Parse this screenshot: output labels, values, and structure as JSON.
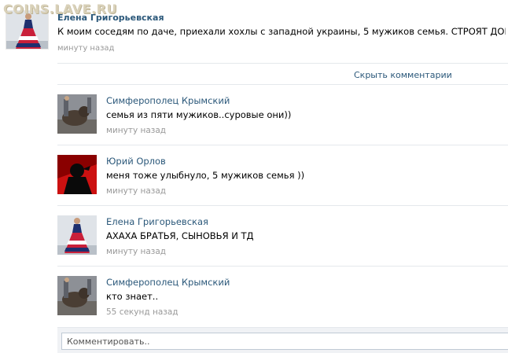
{
  "watermark": "COINS.LAVE.RU",
  "post": {
    "author": "Елена Григорьевская",
    "text": "К моим соседям по даче, приехали хохлы с западной украины, 5 мужиков семья. СТРОЯТ ДОМ...",
    "time": "минуту назад"
  },
  "hide_comments_label": "Скрыть комментарии",
  "comments": [
    {
      "author": "Симферополец Крымский",
      "text": "семья из пяти мужиков..суровые они))",
      "time": "минуту назад",
      "avatar": "bear-photo"
    },
    {
      "author": "Юрий Орлов",
      "text": "меня тоже улыбнуло, 5 мужиков семья ))",
      "time": "минуту назад",
      "avatar": "red-silhouette"
    },
    {
      "author": "Елена Григорьевская",
      "text": "АХАХА БРАТЬЯ, СЫНОВЬЯ И ТД",
      "time": "минуту назад",
      "avatar": "dress-photo"
    },
    {
      "author": "Симферополец Крымский",
      "text": "кто знает..",
      "time": "55 секунд назад",
      "avatar": "bear-photo"
    }
  ],
  "reply": {
    "placeholder": "Комментировать.."
  }
}
